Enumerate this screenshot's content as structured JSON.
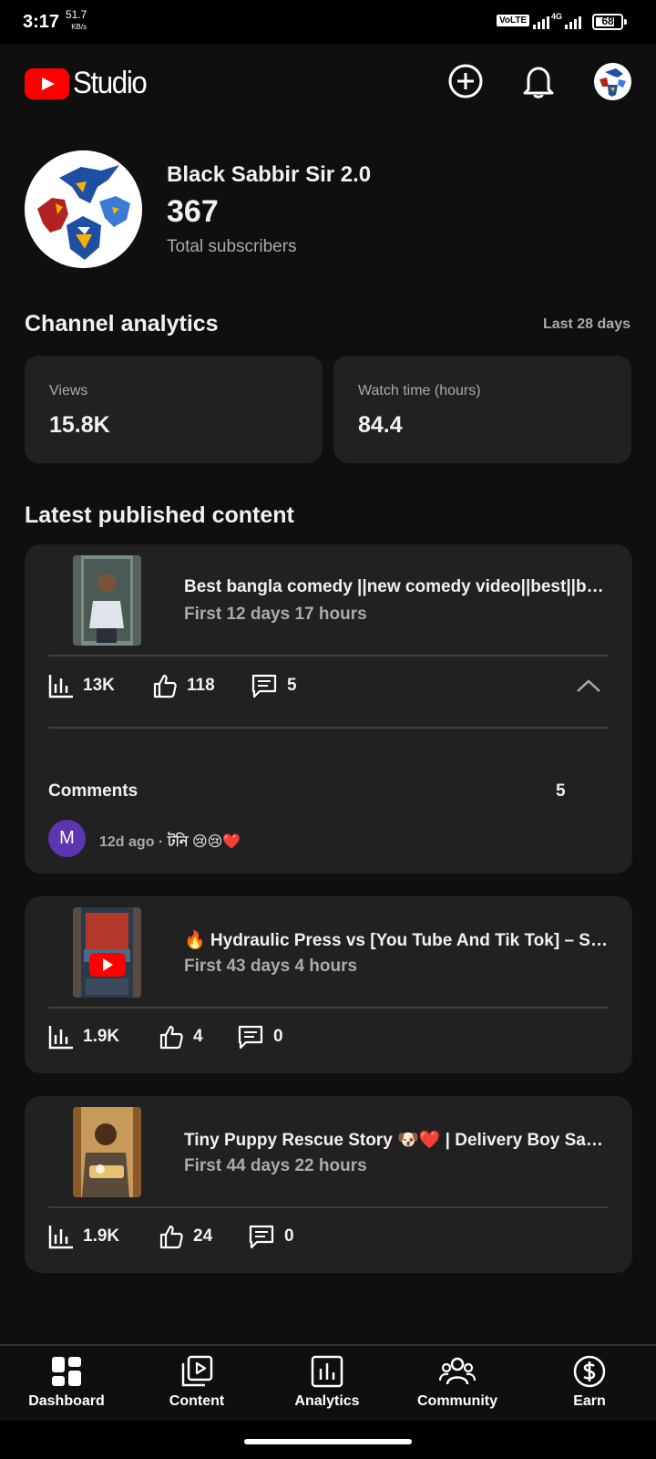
{
  "status_bar": {
    "time": "3:17",
    "speed_value": "51.7",
    "speed_unit": "KB/s",
    "volte": "VoLTE",
    "network": "4G",
    "battery": "68"
  },
  "header": {
    "logo_text": "Studio",
    "icons": [
      "add-circle-icon",
      "bell-icon",
      "avatar"
    ]
  },
  "channel": {
    "name": "Black Sabbir Sir 2.0",
    "subscribers": "367",
    "subscribers_label": "Total subscribers"
  },
  "analytics": {
    "title": "Channel analytics",
    "period": "Last 28 days",
    "cards": [
      {
        "label": "Views",
        "value": "15.8K"
      },
      {
        "label": "Watch time (hours)",
        "value": "84.4"
      }
    ]
  },
  "latest": {
    "title": "Latest published content",
    "videos": [
      {
        "title": "Best bangla comedy ||new comedy video||best||be…",
        "subtitle": "First 12 days 17 hours",
        "views": "13K",
        "likes": "118",
        "comments": "5",
        "expanded": true,
        "comments_label": "Comments",
        "comments_total": "5",
        "top_comment": {
          "avatar_letter": "M",
          "meta": "12d ago · ",
          "text": "টনি 😢😢❤️"
        }
      },
      {
        "title": "🔥 Hydraulic Press vs [You Tube And Tik Tok] – Sa…",
        "subtitle": "First 43 days 4 hours",
        "views": "1.9K",
        "likes": "4",
        "comments": "0"
      },
      {
        "title": "Tiny Puppy Rescue Story 🐶❤️ | Delivery Boy Sav…",
        "subtitle": "First 44 days 22 hours",
        "views": "1.9K",
        "likes": "24",
        "comments": "0"
      }
    ]
  },
  "bottom_nav": {
    "items": [
      {
        "label": "Dashboard",
        "icon": "dashboard-icon"
      },
      {
        "label": "Content",
        "icon": "content-icon"
      },
      {
        "label": "Analytics",
        "icon": "analytics-icon"
      },
      {
        "label": "Community",
        "icon": "community-icon"
      },
      {
        "label": "Earn",
        "icon": "earn-icon"
      }
    ]
  }
}
